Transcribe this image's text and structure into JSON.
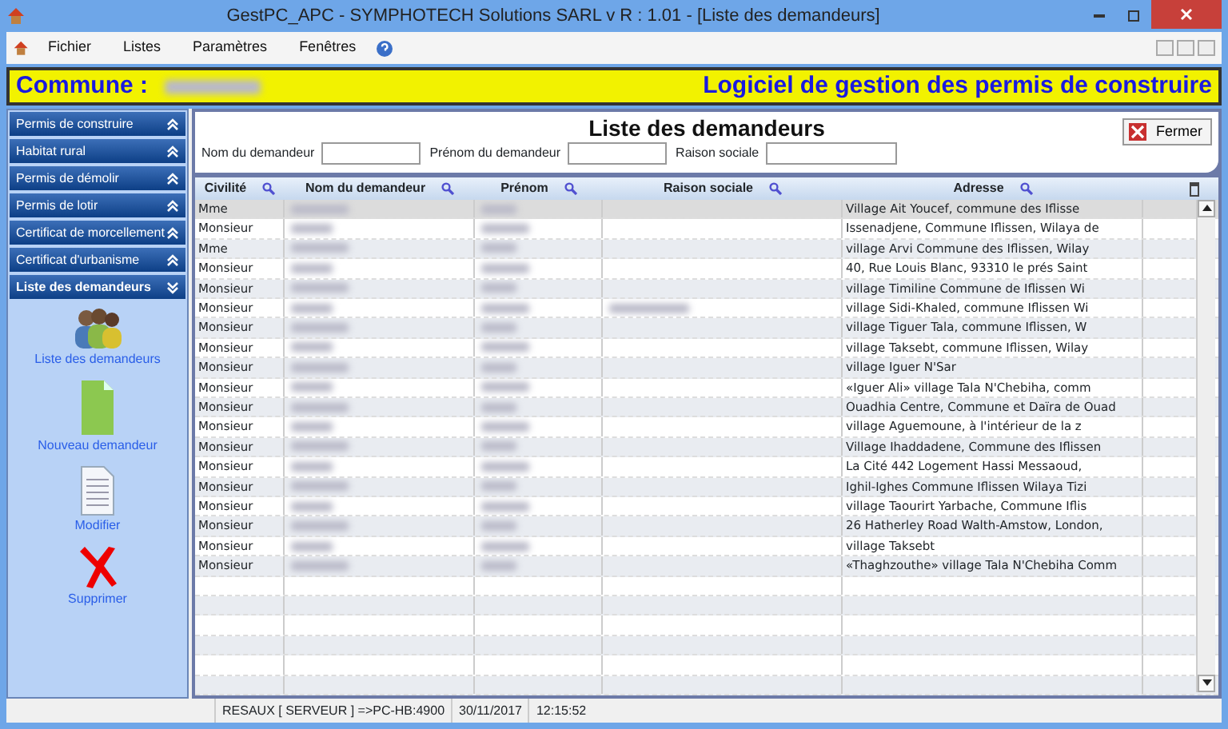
{
  "window": {
    "title": "GestPC_APC - SYMPHOTECH Solutions SARL  v R : 1.01  - [Liste des demandeurs]"
  },
  "menu": [
    {
      "label": "Fichier",
      "kind": "text"
    },
    {
      "label": "Listes",
      "kind": "text"
    },
    {
      "label": "Paramètres",
      "kind": "text"
    },
    {
      "label": "Fenêtres",
      "kind": "text"
    },
    {
      "kind": "help"
    }
  ],
  "banner": {
    "label": "Commune :",
    "value_blurred": true,
    "slogan": "Logiciel de gestion des permis de construire"
  },
  "sidebar": {
    "sections": [
      {
        "label": "Permis de construire",
        "expanded": false
      },
      {
        "label": "Habitat rural",
        "expanded": false
      },
      {
        "label": "Permis de démolir",
        "expanded": false
      },
      {
        "label": "Permis de lotir",
        "expanded": false
      },
      {
        "label": "Certificat de morcellement",
        "expanded": false
      },
      {
        "label": "Certificat d'urbanisme",
        "expanded": false
      },
      {
        "label": "Liste des demandeurs",
        "expanded": true
      }
    ],
    "actions": [
      {
        "label": "Liste des demandeurs",
        "kind": "people"
      },
      {
        "label": "Nouveau demandeur",
        "kind": "new"
      },
      {
        "label": "Modifier",
        "kind": "doc"
      },
      {
        "label": "Supprimer",
        "kind": "delete"
      }
    ]
  },
  "page": {
    "title": "Liste des demandeurs",
    "close_button": "Fermer",
    "filters": [
      {
        "label": "Nom du demandeur"
      },
      {
        "label": "Prénom du demandeur"
      },
      {
        "label": "Raison sociale"
      }
    ]
  },
  "table": {
    "columns": [
      {
        "label": "Civilité"
      },
      {
        "label": "Nom du demandeur"
      },
      {
        "label": "Prénom"
      },
      {
        "label": "Raison sociale"
      },
      {
        "label": "Adresse"
      }
    ],
    "rows": [
      {
        "civilite": "Mme",
        "nom_blurred": true,
        "prenom_blurred": true,
        "raison_blurred": false,
        "adresse": "Village  Ait Youcef, commune des Iflisse",
        "selected": true
      },
      {
        "civilite": "Monsieur",
        "nom_blurred": true,
        "prenom_blurred": true,
        "raison_blurred": false,
        "adresse": "Issenadjene, Commune Iflissen, Wilaya de",
        "selected": false
      },
      {
        "civilite": "Mme",
        "nom_blurred": true,
        "prenom_blurred": true,
        "raison_blurred": false,
        "adresse": "village Arvi Commune des Iflissen, Wilay",
        "selected": false
      },
      {
        "civilite": "Monsieur",
        "nom_blurred": true,
        "prenom_blurred": true,
        "raison_blurred": false,
        "adresse": "40, Rue Louis Blanc, 93310 le prés Saint",
        "selected": false
      },
      {
        "civilite": "Monsieur",
        "nom_blurred": true,
        "prenom_blurred": true,
        "raison_blurred": false,
        "adresse": "village Timiline Commune de Iflissen Wi",
        "selected": false
      },
      {
        "civilite": "Monsieur",
        "nom_blurred": true,
        "prenom_blurred": true,
        "raison_blurred": true,
        "adresse": "village Sidi-Khaled, commune Iflissen Wi",
        "selected": false
      },
      {
        "civilite": "Monsieur",
        "nom_blurred": true,
        "prenom_blurred": true,
        "raison_blurred": false,
        "adresse": "village Tiguer Tala, commune Iflissen, W",
        "selected": false
      },
      {
        "civilite": "Monsieur",
        "nom_blurred": true,
        "prenom_blurred": true,
        "raison_blurred": false,
        "adresse": "village Taksebt, commune Iflissen, Wilay",
        "selected": false
      },
      {
        "civilite": "Monsieur",
        "nom_blurred": true,
        "prenom_blurred": true,
        "raison_blurred": false,
        "adresse": "village Iguer N'Sar",
        "selected": false
      },
      {
        "civilite": "Monsieur",
        "nom_blurred": true,
        "prenom_blurred": true,
        "raison_blurred": false,
        "adresse": "«Iguer Ali» village Tala N'Chebiha, comm",
        "selected": false
      },
      {
        "civilite": "Monsieur",
        "nom_blurred": true,
        "prenom_blurred": true,
        "raison_blurred": false,
        "adresse": "Ouadhia Centre, Commune et Daïra de Ouad",
        "selected": false
      },
      {
        "civilite": "Monsieur",
        "nom_blurred": true,
        "prenom_blurred": true,
        "raison_blurred": false,
        "adresse": "village Aguemoune, à l'intérieur de la z",
        "selected": false
      },
      {
        "civilite": "Monsieur",
        "nom_blurred": true,
        "prenom_blurred": true,
        "raison_blurred": false,
        "adresse": "Village Ihaddadene, Commune des Iflissen",
        "selected": false
      },
      {
        "civilite": "Monsieur",
        "nom_blurred": true,
        "prenom_blurred": true,
        "raison_blurred": false,
        "adresse": "La Cité 442 Logement Hassi Messaoud,",
        "selected": false
      },
      {
        "civilite": "Monsieur",
        "nom_blurred": true,
        "prenom_blurred": true,
        "raison_blurred": false,
        "adresse": "Ighil-Ighes Commune Iflissen Wilaya Tizi",
        "selected": false
      },
      {
        "civilite": "Monsieur",
        "nom_blurred": true,
        "prenom_blurred": true,
        "raison_blurred": false,
        "adresse": "village Taourirt Yarbache, Commune Iflis",
        "selected": false
      },
      {
        "civilite": "Monsieur",
        "nom_blurred": true,
        "prenom_blurred": true,
        "raison_blurred": false,
        "adresse": "26 Hatherley Road Walth-Amstow, London,",
        "selected": false
      },
      {
        "civilite": "Monsieur",
        "nom_blurred": true,
        "prenom_blurred": true,
        "raison_blurred": false,
        "adresse": "village Taksebt",
        "selected": false
      },
      {
        "civilite": "Monsieur",
        "nom_blurred": true,
        "prenom_blurred": true,
        "raison_blurred": false,
        "adresse": "«Thaghzouthe» village Tala N'Chebiha Comm",
        "selected": false
      }
    ]
  },
  "status_bar": [
    "RESAUX [ SERVEUR ] =>PC-HB:4900",
    "30/11/2017",
    "12:15:52"
  ]
}
